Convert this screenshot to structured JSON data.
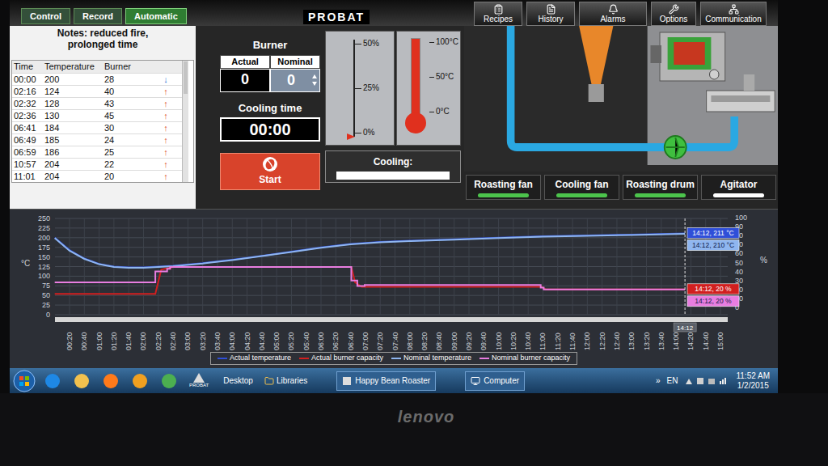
{
  "top_bar": {
    "mode_tabs": [
      {
        "label": "Control",
        "selected": false
      },
      {
        "label": "Record",
        "selected": false
      },
      {
        "label": "Automatic",
        "selected": true
      }
    ],
    "logo": "PROBAT",
    "nav_buttons": [
      "Recipes",
      "History",
      "Alarms",
      "Options",
      "Communication"
    ]
  },
  "notes": {
    "label": "Notes:",
    "text": "reduced fire, prolonged time"
  },
  "log_table": {
    "columns": [
      "Time",
      "Temperature",
      "Burner"
    ],
    "rows": [
      {
        "time": "00:00",
        "temperature": "200",
        "burner": "28",
        "arrow": "↓",
        "color": "#2f6fd6"
      },
      {
        "time": "02:16",
        "temperature": "124",
        "burner": "40",
        "arrow": "↑",
        "color": "#d9442a"
      },
      {
        "time": "02:32",
        "temperature": "128",
        "burner": "43",
        "arrow": "↑",
        "color": "#d9442a"
      },
      {
        "time": "02:36",
        "temperature": "130",
        "burner": "45",
        "arrow": "↑",
        "color": "#d9442a"
      },
      {
        "time": "06:41",
        "temperature": "184",
        "burner": "30",
        "arrow": "↑",
        "color": "#d9442a"
      },
      {
        "time": "06:49",
        "temperature": "185",
        "burner": "24",
        "arrow": "↑",
        "color": "#d9442a"
      },
      {
        "time": "06:59",
        "temperature": "186",
        "burner": "25",
        "arrow": "↑",
        "color": "#d9442a"
      },
      {
        "time": "10:57",
        "temperature": "204",
        "burner": "22",
        "arrow": "↑",
        "color": "#d9442a"
      },
      {
        "time": "11:01",
        "temperature": "204",
        "burner": "20",
        "arrow": "↑",
        "color": "#d9442a"
      }
    ]
  },
  "burner": {
    "title": "Burner",
    "actual_label": "Actual",
    "nominal_label": "Nominal",
    "actual": "0",
    "nominal": "0"
  },
  "cooling_time": {
    "label": "Cooling time",
    "value": "00:00"
  },
  "start_button": "Start",
  "burner_gauge": {
    "ticks": [
      "50%",
      "25%",
      "0%"
    ],
    "level": 0
  },
  "thermometer": {
    "ticks": [
      "100°C",
      "50°C",
      "0°C"
    ],
    "level": 1
  },
  "cooling": {
    "label": "Cooling:",
    "level": 0
  },
  "machine_buttons": [
    {
      "label": "Roasting fan",
      "on": true
    },
    {
      "label": "Cooling fan",
      "on": true
    },
    {
      "label": "Roasting drum",
      "on": true
    },
    {
      "label": "Agitator",
      "on": false
    }
  ],
  "chart": {
    "y_left_ticks": [
      "250",
      "225",
      "200",
      "175",
      "150",
      "125",
      "100",
      "75",
      "50",
      "25",
      "0"
    ],
    "y_left_unit": "°C",
    "y_right_ticks": [
      "100",
      "90",
      "80",
      "70",
      "60",
      "50",
      "40",
      "30",
      "20",
      "10",
      "0"
    ],
    "y_right_unit": "%",
    "x_ticks": [
      "00:20",
      "00:40",
      "01:00",
      "01:20",
      "01:40",
      "02:00",
      "02:20",
      "02:40",
      "03:00",
      "03:20",
      "03:40",
      "04:00",
      "04:20",
      "04:40",
      "05:00",
      "05:20",
      "05:40",
      "06:00",
      "06:20",
      "06:40",
      "07:00",
      "07:20",
      "07:40",
      "08:00",
      "08:20",
      "08:40",
      "09:00",
      "09:20",
      "09:40",
      "10:00",
      "10:20",
      "10:40",
      "11:00",
      "11:20",
      "11:40",
      "12:00",
      "12:20",
      "12:40",
      "13:00",
      "13:20",
      "13:40",
      "14:00",
      "14:20",
      "14:40",
      "15:00"
    ],
    "cursor_label": "14:12",
    "series": [
      {
        "name": "Actual temperature",
        "kind": "temperature",
        "color": "#2f4fd8",
        "tooltip": "14:12, 211 °C",
        "times": [
          "00:00",
          "00:20",
          "00:40",
          "01:00",
          "01:20",
          "01:40",
          "02:00",
          "02:40",
          "03:20",
          "04:00",
          "04:40",
          "05:20",
          "06:00",
          "06:40",
          "07:20",
          "08:00",
          "09:00",
          "10:00",
          "11:00",
          "12:00",
          "13:00",
          "14:12"
        ],
        "values": [
          200,
          168,
          146,
          132,
          125,
          123,
          123,
          127,
          134,
          143,
          153,
          164,
          175,
          184,
          189,
          192,
          196,
          200,
          204,
          206,
          208,
          211
        ]
      },
      {
        "name": "Actual burner capacity",
        "kind": "burner",
        "color": "#d11f1f",
        "tooltip": "14:12, 20 %",
        "times": [
          "00:00",
          "02:16",
          "02:24",
          "02:40",
          "06:41",
          "06:46",
          "06:55",
          "10:58",
          "11:04",
          "14:12"
        ],
        "values": [
          15,
          15,
          42,
          45,
          45,
          28,
          23,
          23,
          20,
          20
        ]
      },
      {
        "name": "Nominal temperature",
        "kind": "temperature",
        "color": "#8fb6f0",
        "tooltip": "14:12, 210 °C",
        "times": [
          "00:00",
          "00:20",
          "00:40",
          "01:00",
          "01:20",
          "01:40",
          "02:00",
          "02:40",
          "03:20",
          "04:00",
          "04:40",
          "05:20",
          "06:00",
          "06:40",
          "07:20",
          "08:00",
          "09:00",
          "10:00",
          "11:00",
          "12:00",
          "13:00",
          "14:12"
        ],
        "values": [
          199,
          166,
          145,
          131,
          124,
          122,
          122,
          126,
          133,
          142,
          152,
          163,
          174,
          183,
          188,
          191,
          195,
          199,
          203,
          205,
          207,
          210
        ]
      },
      {
        "name": "Nominal burner capacity",
        "kind": "burner",
        "color": "#e87de0",
        "tooltip": "14:12, 20 %",
        "times": [
          "00:00",
          "02:16",
          "02:16",
          "02:32",
          "02:32",
          "02:36",
          "02:36",
          "06:41",
          "06:41",
          "06:49",
          "06:49",
          "06:59",
          "06:59",
          "10:57",
          "10:57",
          "11:01",
          "11:01",
          "14:12"
        ],
        "values": [
          28,
          28,
          40,
          40,
          43,
          43,
          45,
          45,
          30,
          30,
          24,
          24,
          25,
          25,
          22,
          22,
          20,
          20
        ]
      }
    ]
  },
  "taskbar": {
    "pinned_app_label": "PROBAT",
    "toolbar_labels": [
      "Desktop",
      "Libraries"
    ],
    "windows": [
      {
        "label": "Happy Bean Roaster",
        "selected": false
      },
      {
        "label": "Computer",
        "selected": false
      }
    ],
    "overflow": "»",
    "language": "EN",
    "time": "11:52 AM",
    "date": "1/2/2015"
  },
  "bezel": {
    "brand": "lenovo"
  }
}
